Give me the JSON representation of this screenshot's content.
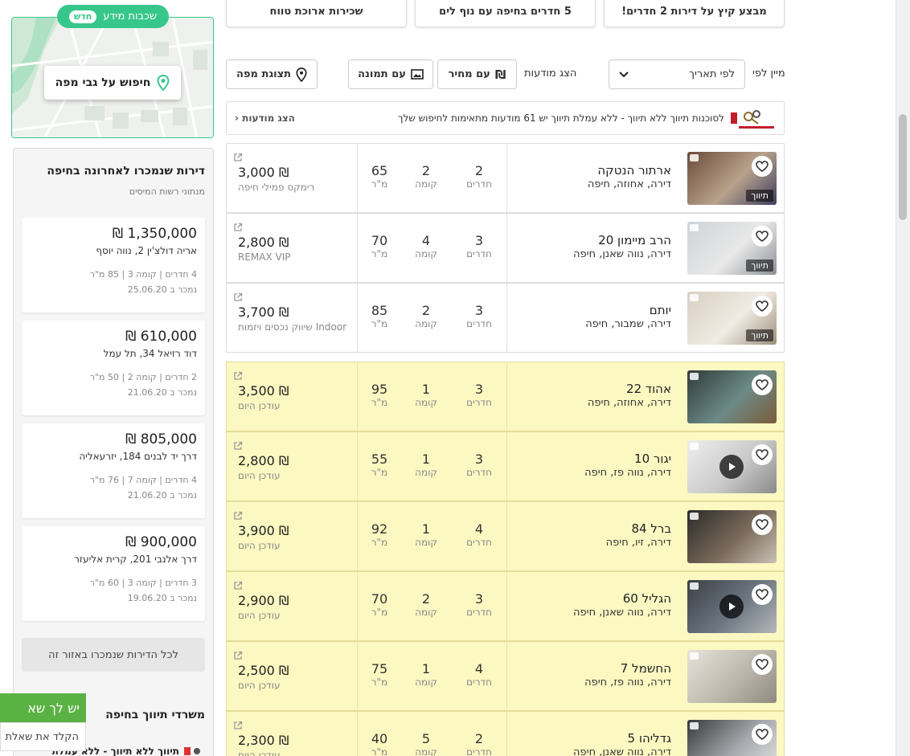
{
  "promos": [
    {
      "label": "מבצע קיץ על דירות 2 חדרים!"
    },
    {
      "label": "5 חדרים בחיפה עם נוף לים"
    },
    {
      "label": "שכירות ארוכת טווח"
    }
  ],
  "map": {
    "badge_text": "שכבות מידע",
    "badge_pill": "חדש",
    "search_label": "חיפוש על גבי מפה"
  },
  "sold": {
    "title": "דירות שנמכרו לאחרונה בחיפה",
    "subtitle": "מנתוני רשות המיסים",
    "items": [
      {
        "price": "1,350,000 ₪",
        "address": "אריה דולצ'ין 2, נווה יוסף",
        "details": "4 חדרים | קומה 3 | 85 מ\"ר",
        "date": "נמכר ב 25.06.20"
      },
      {
        "price": "610,000 ₪",
        "address": "דוד רזיאל 34, תל עמל",
        "details": "2 חדרים | קומה 2 | 50 מ\"ר",
        "date": "נמכר ב 21.06.20"
      },
      {
        "price": "805,000 ₪",
        "address": "דרך יד לבנים 184, יזרעאליה",
        "details": "4 חדרים | קומה 7 | 76 מ\"ר",
        "date": "נמכר ב 21.06.20"
      },
      {
        "price": "900,000 ₪",
        "address": "דרך אלנבי 201, קרית אליעזר",
        "details": "3 חדרים | קומה 3 | 60 מ\"ר",
        "date": "נמכר ב 19.06.20"
      }
    ],
    "all_button": "לכל הדירות שנמכרו באזור זה",
    "brokers_title": "משרדי תיווך בחיפה",
    "broker_item": "תיווך ללא תיווך - ללא עמלת"
  },
  "chat": {
    "header": "יש לך שא",
    "input_placeholder": "הקלד את שאלת"
  },
  "filters": {
    "sort_label": "מיין לפי",
    "sort_value": "לפי תאריך",
    "show_label": "הצג מודעות",
    "with_price": "עם מחיר",
    "with_photo": "עם תמונה",
    "map_view": "תצוגת מפה"
  },
  "ad": {
    "text": "לסוכנות תיווך ללא תיווך - ללא עמלת תיווך יש 61 מודעות מתאימות לחיפוש שלך",
    "show_link": "הצג מודעות"
  },
  "listings": [
    {
      "street": "ארתור הנטקה",
      "city": "דירה, אחוזה, חיפה",
      "rooms": "2",
      "rooms_label": "חדרים",
      "floor": "2",
      "floor_label": "קומה",
      "sqm": "65",
      "sqm_label": "מ\"ר",
      "price": "3,000 ₪",
      "agency": "רימקס פמילי חיפה",
      "tag": "תיווך",
      "video": false,
      "highlight": false
    },
    {
      "street": "הרב מיימון 20",
      "city": "דירה, נווה שאנן, חיפה",
      "rooms": "3",
      "rooms_label": "חדרים",
      "floor": "4",
      "floor_label": "קומה",
      "sqm": "70",
      "sqm_label": "מ\"ר",
      "price": "2,800 ₪",
      "agency": "REMAX VIP",
      "tag": "תיווך",
      "video": false,
      "highlight": false
    },
    {
      "street": "יותם",
      "city": "דירה, שמבור, חיפה",
      "rooms": "3",
      "rooms_label": "חדרים",
      "floor": "2",
      "floor_label": "קומה",
      "sqm": "85",
      "sqm_label": "מ\"ר",
      "price": "3,700 ₪",
      "agency": "Indoor שיווק נכסים ויזמות",
      "tag": "תיווך",
      "video": false,
      "highlight": false
    },
    {
      "street": "אהוד 22",
      "city": "דירה, אחוזה, חיפה",
      "rooms": "3",
      "rooms_label": "חדרים",
      "floor": "1",
      "floor_label": "קומה",
      "sqm": "95",
      "sqm_label": "מ\"ר",
      "price": "3,500 ₪",
      "agency": "עודכן היום",
      "tag": "",
      "video": false,
      "highlight": true
    },
    {
      "street": "יגור 10",
      "city": "דירה, נווה פז, חיפה",
      "rooms": "3",
      "rooms_label": "חדרים",
      "floor": "1",
      "floor_label": "קומה",
      "sqm": "55",
      "sqm_label": "מ\"ר",
      "price": "2,800 ₪",
      "agency": "עודכן היום",
      "tag": "",
      "video": true,
      "highlight": true
    },
    {
      "street": "ברל 84",
      "city": "דירה, זיו, חיפה",
      "rooms": "4",
      "rooms_label": "חדרים",
      "floor": "1",
      "floor_label": "קומה",
      "sqm": "92",
      "sqm_label": "מ\"ר",
      "price": "3,900 ₪",
      "agency": "עודכן היום",
      "tag": "",
      "video": false,
      "highlight": true
    },
    {
      "street": "הגליל 60",
      "city": "דירה, נווה שאנן, חיפה",
      "rooms": "3",
      "rooms_label": "חדרים",
      "floor": "2",
      "floor_label": "קומה",
      "sqm": "70",
      "sqm_label": "מ\"ר",
      "price": "2,900 ₪",
      "agency": "עודכן היום",
      "tag": "",
      "video": true,
      "highlight": true
    },
    {
      "street": "החשמל 7",
      "city": "דירה, נווה פז, חיפה",
      "rooms": "4",
      "rooms_label": "חדרים",
      "floor": "1",
      "floor_label": "קומה",
      "sqm": "75",
      "sqm_label": "מ\"ר",
      "price": "2,500 ₪",
      "agency": "עודכן היום",
      "tag": "",
      "video": false,
      "highlight": true
    },
    {
      "street": "גדליהו 5",
      "city": "דירה, נווה שאנן, חיפה",
      "rooms": "2",
      "rooms_label": "חדרים",
      "floor": "5",
      "floor_label": "קומה",
      "sqm": "40",
      "sqm_label": "מ\"ר",
      "price": "2,300 ₪",
      "agency": "עודכן היום",
      "tag": "",
      "video": false,
      "highlight": true
    }
  ],
  "colors": {
    "accent_green": "#38c78a",
    "highlight_yellow": "#fcf8c2",
    "chat_green": "#5ab244"
  }
}
